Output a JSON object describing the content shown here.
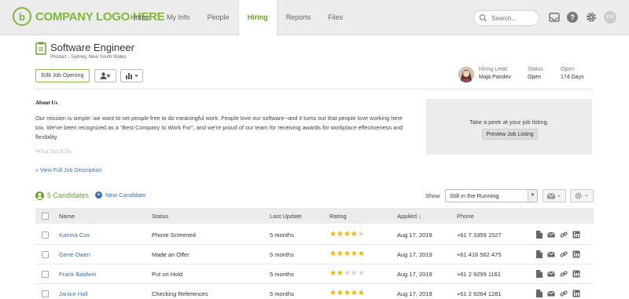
{
  "brand": {
    "logo_text": "COMPANY LOGO HERE",
    "logo_mark": "b"
  },
  "nav": {
    "items": [
      "Home",
      "My Info",
      "People",
      "Hiring",
      "Reports",
      "Files"
    ],
    "active": "Hiring"
  },
  "search": {
    "placeholder": "Search..."
  },
  "user": {
    "initials": "KM"
  },
  "job": {
    "title": "Software Engineer",
    "subtitle": "Product - Sydney, New South Wales",
    "edit_button": "Edit Job Opening",
    "hiring_lead_label": "Hiring Lead",
    "hiring_lead": "Maja Pandev",
    "status_label": "Status",
    "status": "Open",
    "open_label": "Open",
    "open_days": "174 Days"
  },
  "about": {
    "heading": "About Us",
    "text": "Our mission is simple: we want to set people free to do meaningful work. People love our software--and it turns out that people love working here too. We've been recognized as a “Best Company to Work For”, and we're proud of our team for receiving awards for workplace effectiveness and flexibility.",
    "faded_heading": "What You'll Do",
    "view_full": "» View Full Job Description"
  },
  "peek": {
    "text": "Take a peek at your job listing.",
    "button": "Preview Job Listing"
  },
  "candidates": {
    "title": "5 Candidates",
    "new_label": "New Candidate",
    "show_label": "Show",
    "filter_value": "Still in the Running",
    "columns": [
      "Name",
      "Status",
      "Last Update",
      "Rating",
      "Applied ↓",
      "Phone"
    ],
    "rows": [
      {
        "name": "Katrina Cox",
        "status": "Phone Screened",
        "last_update": "5 months",
        "rating": 4,
        "applied": "Aug 17, 2019",
        "phone": "+61 7 3359 1527"
      },
      {
        "name": "Gene Owen",
        "status": "Made an Offer",
        "last_update": "5 months",
        "rating": 5,
        "applied": "Aug 17, 2019",
        "phone": "+61 416 562 475"
      },
      {
        "name": "Frank Baldwin",
        "status": "Put on Hold",
        "last_update": "5 months",
        "rating": 2,
        "applied": "Aug 17, 2019",
        "phone": "+61 2 9299 1161"
      },
      {
        "name": "Janice Hall",
        "status": "Checking References",
        "last_update": "5 months",
        "rating": 5,
        "applied": "Aug 17, 2019",
        "phone": "+61 2 9264 1281"
      }
    ]
  },
  "colors": {
    "brand_green": "#7fb838",
    "link_blue": "#3a70b5",
    "star": "#f5b400"
  }
}
